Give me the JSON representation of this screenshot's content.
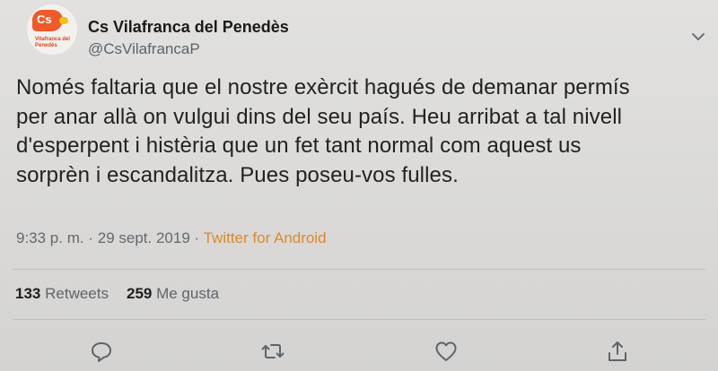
{
  "profile": {
    "avatar_text": "Cs",
    "avatar_subtext": "Vilafranca del Penedès",
    "display_name": "Cs Vilafranca del Penedès",
    "handle": "@CsVilafrancaP"
  },
  "tweet": {
    "lines": [
      "Només faltaria que el nostre exèrcit hagués de demanar permís",
      "per anar allà on vulgui dins del seu país. Heu arribat a tal nivell",
      "d'esperpent i histèria que un fet tant normal com aquest us",
      "sorprèn i escandalitza. Pues poseu-vos fulles."
    ]
  },
  "meta": {
    "time": "9:33 p. m.",
    "separator": "·",
    "date": "29 sept. 2019",
    "app": "Twitter for Android"
  },
  "stats": {
    "retweets_count": "133",
    "retweets_label": "Retweets",
    "likes_count": "259",
    "likes_label": "Me gusta"
  },
  "icons": {
    "caret": "chevron-down-icon",
    "reply": "reply-icon",
    "retweet": "retweet-icon",
    "like": "heart-icon",
    "share": "share-icon"
  },
  "colors": {
    "background": "#dcdbd9",
    "text": "#222222",
    "secondary": "#64696e",
    "app_link": "#d98a2c",
    "brand": "#ee5a2a"
  }
}
